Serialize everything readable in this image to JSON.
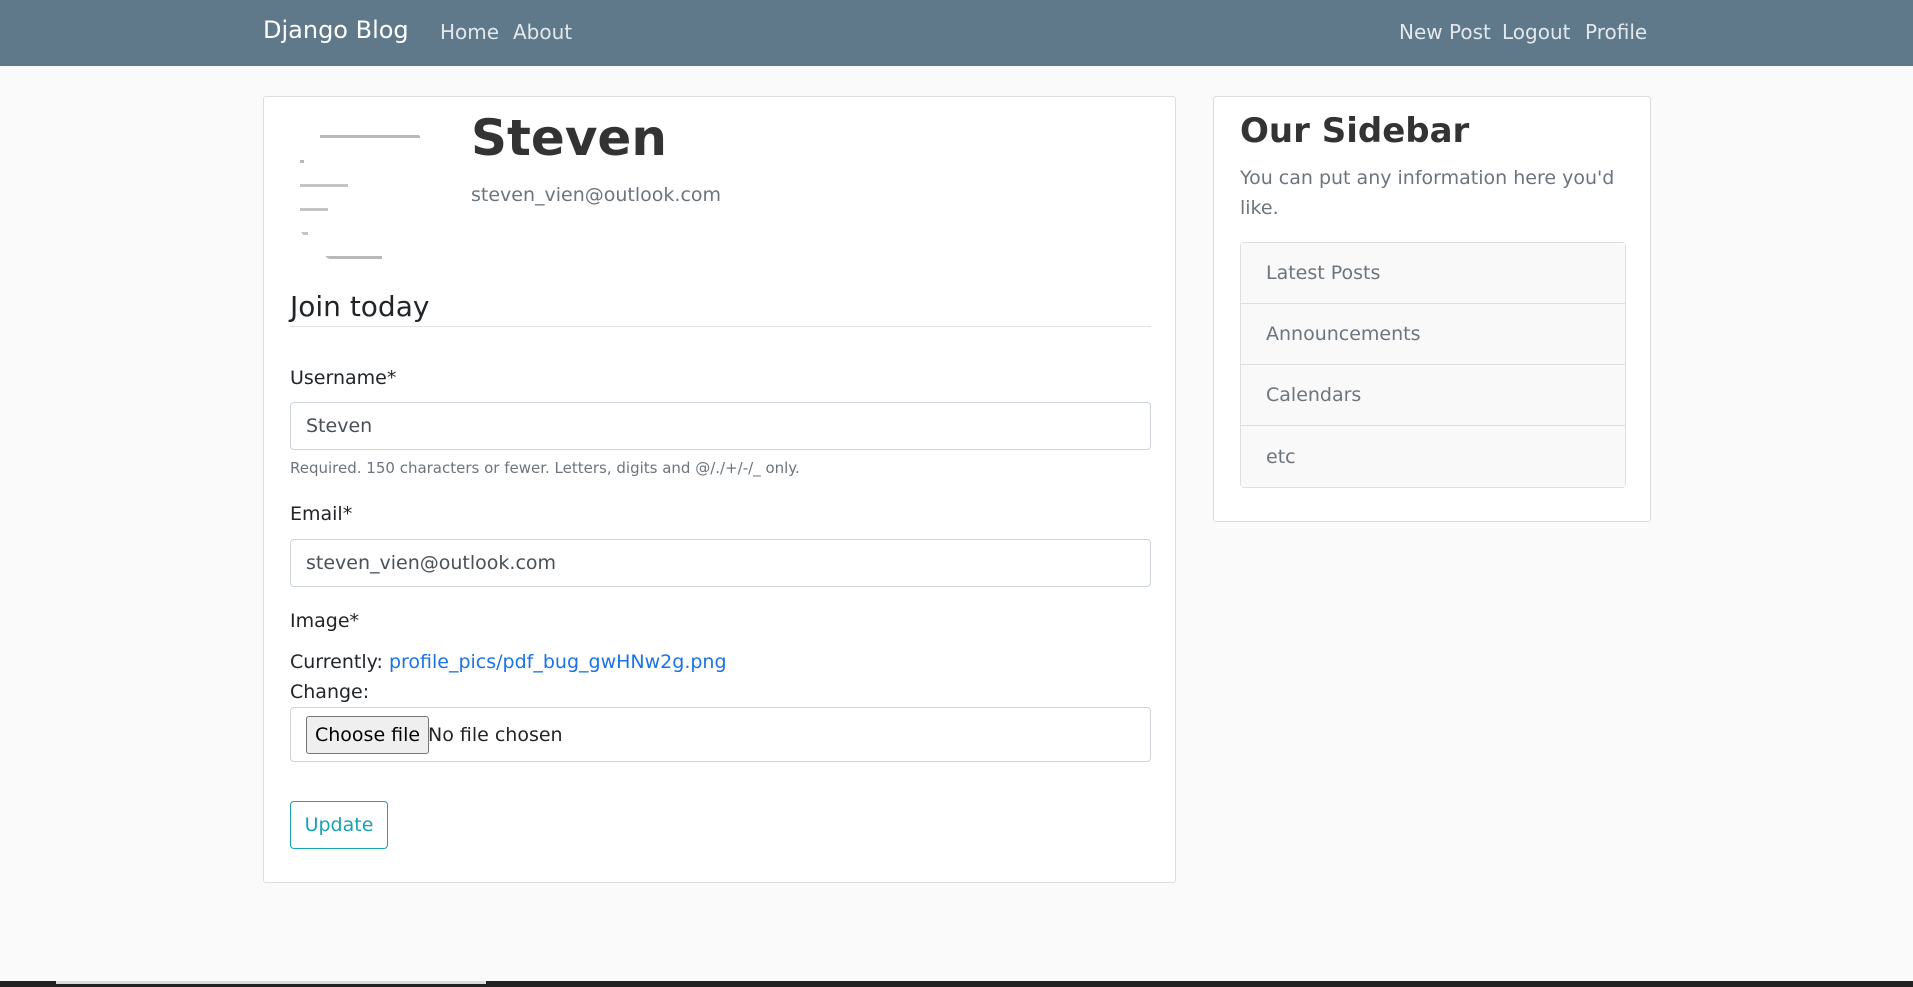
{
  "navbar": {
    "brand": "Django Blog",
    "left_links": [
      "Home",
      "About"
    ],
    "right_links": [
      "New Post",
      "Logout",
      "Profile"
    ]
  },
  "profile": {
    "name": "Steven",
    "email": "steven_vien@outlook.com"
  },
  "form": {
    "legend": "Join today",
    "username_label": "Username*",
    "username_value": "Steven",
    "username_help": "Required. 150 characters or fewer. Letters, digits and @/./+/-/_ only.",
    "email_label": "Email*",
    "email_value": "steven_vien@outlook.com",
    "image_label": "Image*",
    "currently_label": "Currently:",
    "current_file": "profile_pics/pdf_bug_gwHNw2g.png",
    "change_label": "Change:",
    "choose_file_label": "Choose file",
    "no_file_text": "No file chosen",
    "submit_label": "Update"
  },
  "sidebar": {
    "title": "Our Sidebar",
    "text": "You can put any information here you'd like.",
    "items": [
      "Latest Posts",
      "Announcements",
      "Calendars",
      "etc"
    ]
  },
  "colors": {
    "navbar": "#5f788a",
    "link": "#1a73e8",
    "update_button": "#17a2b8"
  }
}
